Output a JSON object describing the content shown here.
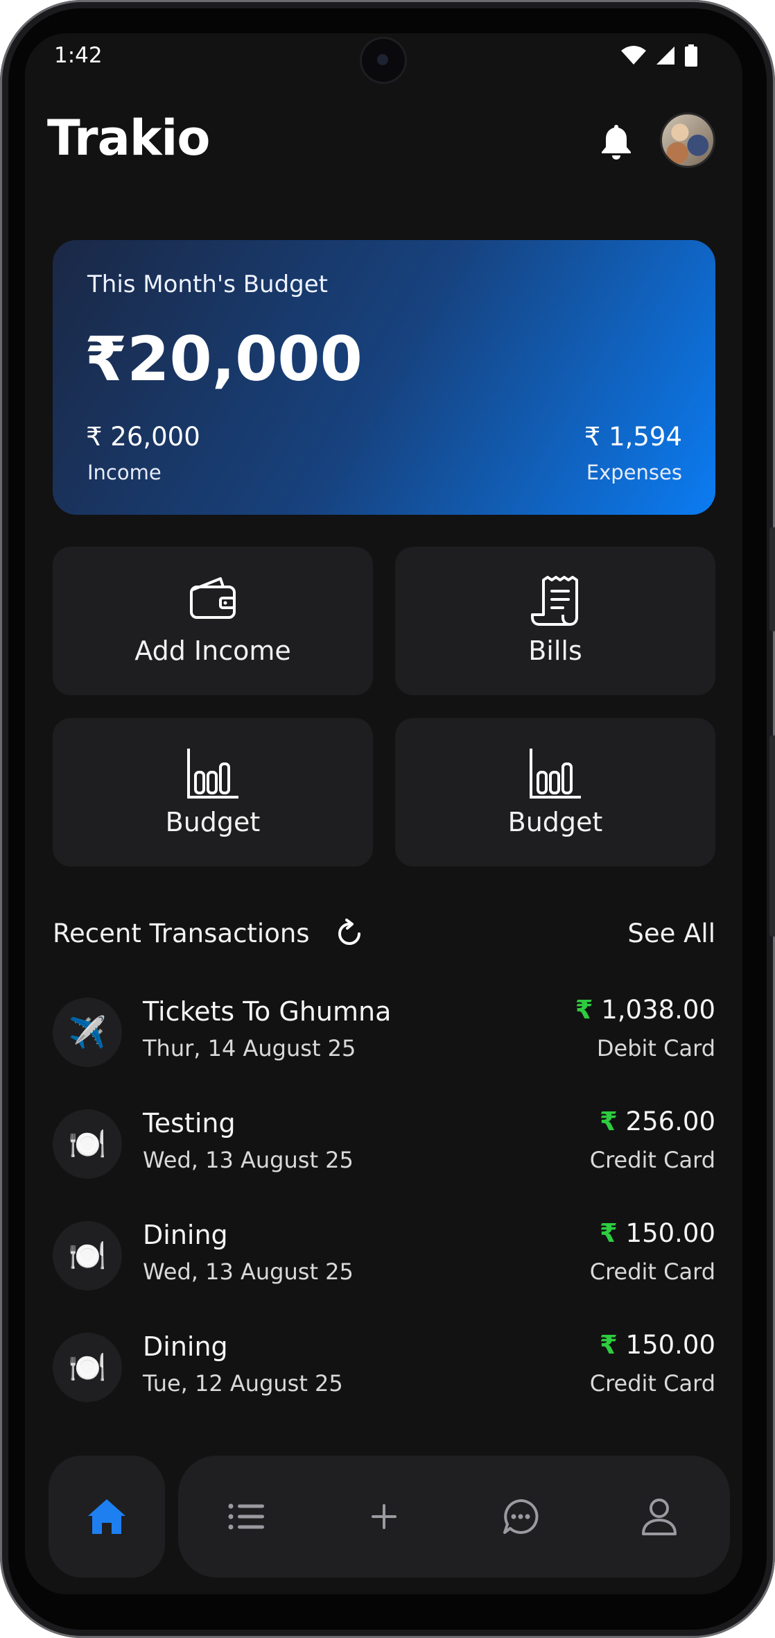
{
  "status_bar": {
    "time": "1:42"
  },
  "header": {
    "app_name": "Trakio"
  },
  "budget_card": {
    "label": "This Month's Budget",
    "amount": "₹20,000",
    "income_value": "₹ 26,000",
    "income_label": "Income",
    "expenses_value": "₹ 1,594",
    "expenses_label": "Expenses"
  },
  "quick_actions": [
    {
      "label": "Add Income",
      "icon": "wallet-icon"
    },
    {
      "label": "Bills",
      "icon": "receipt-icon"
    },
    {
      "label": "Budget",
      "icon": "bar-chart-icon"
    },
    {
      "label": "Budget",
      "icon": "bar-chart-icon"
    }
  ],
  "recent": {
    "title": "Recent Transactions",
    "see_all": "See All",
    "transactions": [
      {
        "icon": "✈️",
        "title": "Tickets To Ghumna",
        "date": "Thur, 14 August 25",
        "currency": "₹",
        "amount": "1,038.00",
        "method": "Debit Card"
      },
      {
        "icon": "🍽️",
        "title": "Testing",
        "date": "Wed, 13 August 25",
        "currency": "₹",
        "amount": "256.00",
        "method": "Credit Card"
      },
      {
        "icon": "🍽️",
        "title": "Dining",
        "date": "Wed, 13 August 25",
        "currency": "₹",
        "amount": "150.00",
        "method": "Credit Card"
      },
      {
        "icon": "🍽️",
        "title": "Dining",
        "date": "Tue, 12 August 25",
        "currency": "₹",
        "amount": "150.00",
        "method": "Credit Card"
      }
    ]
  },
  "bottom_nav": {
    "items": [
      "home-icon",
      "list-icon",
      "plus-icon",
      "chat-icon",
      "profile-icon"
    ],
    "active": "home"
  },
  "colors": {
    "accent": "#1e7ff0",
    "positive": "#2ecc40",
    "background": "#121212",
    "card": "#1e1e20"
  }
}
